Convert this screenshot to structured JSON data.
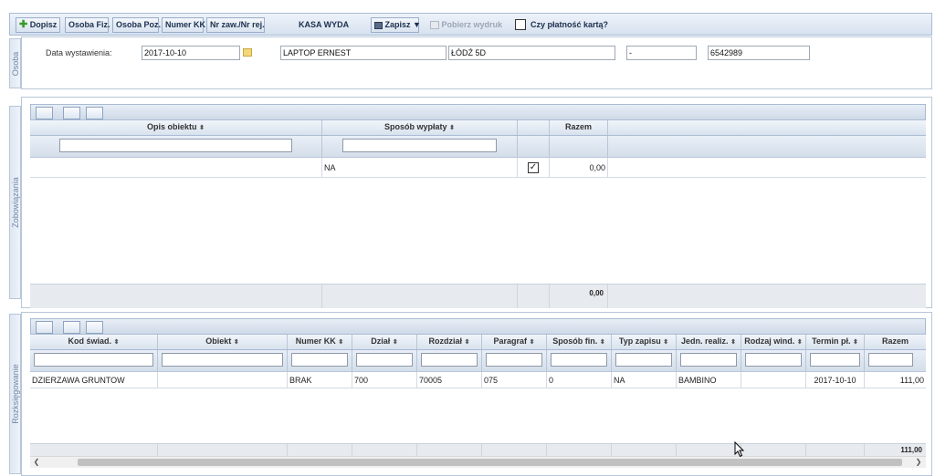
{
  "toolbar": {
    "add_label": "Dopisz",
    "person_label": "Osoba Fiz.",
    "person_poz_label": "Osoba Poz.",
    "kk_label": "Numer KK",
    "nr_label": "Nr zaw./Nr rej.",
    "kasa_label": "KASA WYDA",
    "save_label": "Zapisz ▼",
    "print_label": "Pobierz wydruk",
    "card_label": "Czy płatność kartą?"
  },
  "osoba": {
    "tab_label": "Osoba",
    "date_label": "Data wystawienia:",
    "date_value": "2017-10-10",
    "name_value": "LAPTOP ERNEST",
    "city_value": "ŁÓDŹ 5D",
    "dash_value": "-",
    "number_value": "6542989"
  },
  "zob": {
    "tab_label": "Zobowiązania",
    "headers": [
      "Opis obiektu",
      "Sposób wypłaty",
      "",
      "Razem"
    ],
    "row": {
      "opis": "",
      "sposob": "NA",
      "razem": "0,00"
    },
    "total": "0,00"
  },
  "roz": {
    "tab_label": "Rozksięgowanie",
    "headers": [
      "Kod świad.",
      "Obiekt",
      "Numer KK",
      "Dział",
      "Rozdział",
      "Paragraf",
      "Sposób fin.",
      "Typ zapisu",
      "Jedn. realiz.",
      "Rodzaj wind.",
      "Termin pł.",
      "Razem"
    ],
    "row": [
      "DZIERZAWA GRUNTOW",
      "",
      "BRAK",
      "700",
      "70005",
      "075",
      "0",
      "NA",
      "BAMBINO",
      "",
      "2017-10-10",
      "111,00"
    ],
    "total": "111,00"
  },
  "colors": {
    "accent": "#2b6cb0",
    "add_green": "#3a9a2a"
  }
}
